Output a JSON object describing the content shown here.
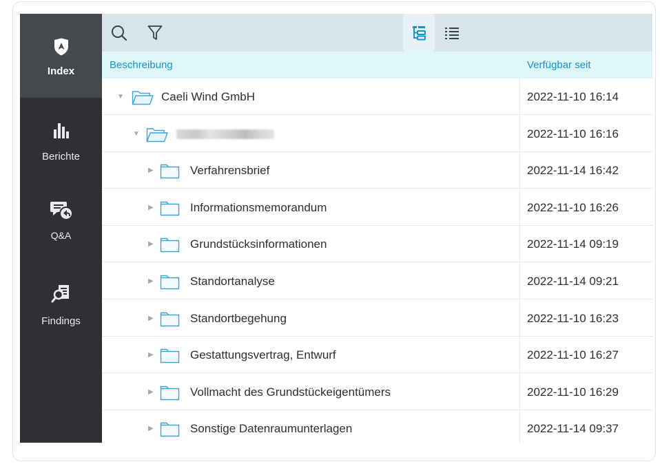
{
  "sidebar": {
    "items": [
      {
        "label": "Index",
        "icon": "shield-icon",
        "active": true
      },
      {
        "label": "Berichte",
        "icon": "bar-chart-icon"
      },
      {
        "label": "Q&A",
        "icon": "chat-reply-icon"
      },
      {
        "label": "Findings",
        "icon": "document-search-icon"
      }
    ]
  },
  "toolbar": {
    "icons": [
      "search-icon",
      "filter-icon",
      "tree-view-icon",
      "list-view-icon"
    ],
    "active_view": "tree"
  },
  "table": {
    "columns": [
      "Beschreibung",
      "Verfügbar seit"
    ],
    "rows": [
      {
        "name": "Caeli Wind GmbH",
        "date": "2022-11-10 16:14",
        "level": 0,
        "expanded": true
      },
      {
        "name": "",
        "date": "2022-11-10 16:16",
        "level": 1,
        "expanded": true,
        "redacted": true
      },
      {
        "name": "Verfahrensbrief",
        "date": "2022-11-14 16:42",
        "level": 2,
        "expanded": false
      },
      {
        "name": "Informationsmemorandum",
        "date": "2022-11-10 16:26",
        "level": 2,
        "expanded": false
      },
      {
        "name": "Grundstücksinformationen",
        "date": "2022-11-14 09:19",
        "level": 2,
        "expanded": false
      },
      {
        "name": "Standortanalyse",
        "date": "2022-11-14 09:21",
        "level": 2,
        "expanded": false
      },
      {
        "name": "Standortbegehung",
        "date": "2022-11-10 16:23",
        "level": 2,
        "expanded": false
      },
      {
        "name": "Gestattungsvertrag, Entwurf",
        "date": "2022-11-10 16:27",
        "level": 2,
        "expanded": false
      },
      {
        "name": "Vollmacht des Grundstückeigentümers",
        "date": "2022-11-10 16:29",
        "level": 2,
        "expanded": false
      },
      {
        "name": "Sonstige Datenraumunterlagen",
        "date": "2022-11-14 09:37",
        "level": 2,
        "expanded": false
      }
    ]
  },
  "colors": {
    "sidebar_bg": "#2e3033",
    "sidebar_active": "#45484d",
    "toolbar_bg": "#d6e4ec",
    "header_bg": "#dff6fb",
    "accent": "#1497cc",
    "folder_stroke": "#3aa6d6"
  }
}
